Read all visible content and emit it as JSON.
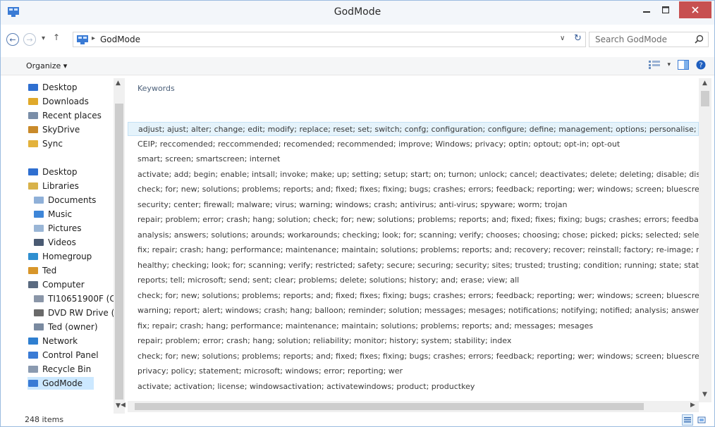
{
  "window": {
    "title": "GodMode"
  },
  "address": {
    "path": "GodMode",
    "separator": "▸"
  },
  "search": {
    "placeholder": "Search GodMode"
  },
  "command_bar": {
    "organize_label": "Organize ▾"
  },
  "nav_pane": {
    "items": [
      {
        "label": "Desktop",
        "icon": "desktop-icon"
      },
      {
        "label": "Downloads",
        "icon": "downloads-icon"
      },
      {
        "label": "Recent places",
        "icon": "recent-places-icon"
      },
      {
        "label": "SkyDrive",
        "icon": "skydrive-icon"
      },
      {
        "label": "Sync",
        "icon": "sync-icon"
      },
      {
        "label": "Desktop",
        "icon": "desktop-icon"
      },
      {
        "label": "Libraries",
        "icon": "libraries-icon"
      },
      {
        "label": "Documents",
        "icon": "documents-icon"
      },
      {
        "label": "Music",
        "icon": "music-icon"
      },
      {
        "label": "Pictures",
        "icon": "pictures-icon"
      },
      {
        "label": "Videos",
        "icon": "videos-icon"
      },
      {
        "label": "Homegroup",
        "icon": "homegroup-icon"
      },
      {
        "label": "Ted",
        "icon": "user-icon"
      },
      {
        "label": "Computer",
        "icon": "computer-icon"
      },
      {
        "label": "TI10651900F (C:",
        "icon": "drive-icon"
      },
      {
        "label": "DVD RW Drive (",
        "icon": "dvd-drive-icon"
      },
      {
        "label": "Ted (owner)",
        "icon": "user-folder-icon"
      },
      {
        "label": "Network",
        "icon": "network-icon"
      },
      {
        "label": "Control Panel",
        "icon": "control-panel-icon"
      },
      {
        "label": "Recycle Bin",
        "icon": "recycle-bin-icon"
      },
      {
        "label": "GodMode",
        "icon": "godmode-icon"
      }
    ]
  },
  "content": {
    "column_header": "Keywords",
    "rows": [
      "adjust; ajust; alter; change; edit; modify; replace; reset; set; switch; confg; configuration; configure; define; management; options; personalise; person...",
      "CEIP; reccomended; reccommended; recomended; recommended; improve; Windows; privacy; optin; optout; opt-in; opt-out",
      "smart; screen; smartscreen; internet",
      "activate; add; begin; enable; intsall; invoke; make; up; setting; setup; start; on; turnon; unlock; cancel; deactivates; delete; deleting; disable; disallow; e...",
      "check; for; new; solutions; problems; reports; and; fixed; fixes; fixing; bugs; crashes; errors; feedback; reporting; wer; windows; screen; bluescreen; cras...",
      "security; center; firewall; malware; virus; warning; windows; crash; antivirus; anti-virus; spyware; worm; trojan",
      "repair; problem; error; crash; hang; solution; check; for; new; solutions; problems; reports; and; fixed; fixes; fixing; bugs; crashes; errors; feedback; rep...",
      "analysis; answers; solutions; arounds; workarounds; checking; look; for; scanning; verify; chooses; choosing; chose; picked; picks; selected; selects; opti...",
      "fix; repair; crash; hang; performance; maintenance; maintain; solutions; problems; reports; and; recovery; recover; reinstall; factory; re-image; reimag...",
      "healthy; checking; look; for; scanning; verify; restricted; safety; secure; securing; security; sites; trusted; trusting; condition; running; state; status; fix; re...",
      "reports; tell; microsoft; send; sent; clear; problems; delete; solutions; history; and; erase; view; all",
      "check; for; new; solutions; problems; reports; and; fixed; fixes; fixing; bugs; crashes; errors; feedback; reporting; wer; windows; screen; bluescreen; cras...",
      "warning; report; alert; windows; crash; hang; balloon; reminder; solution; messages; mesages; notifications; notifying; notified; analysis; answers; solu...",
      "fix; repair; crash; hang; performance; maintenance; maintain; solutions; problems; reports; and; messages; mesages",
      "repair; problem; error; crash; hang; solution; reliability; monitor; history; system; stability; index",
      "check; for; new; solutions; problems; reports; and; fixed; fixes; fixing; bugs; crashes; errors; feedback; reporting; wer; windows; screen; bluescreen; cras...",
      "privacy; policy; statement; microsoft; windows; error; reporting; wer",
      "activate; activation; license; windowsactivation; activatewindows; product; productkey"
    ]
  },
  "status": {
    "item_count": "248 items"
  }
}
